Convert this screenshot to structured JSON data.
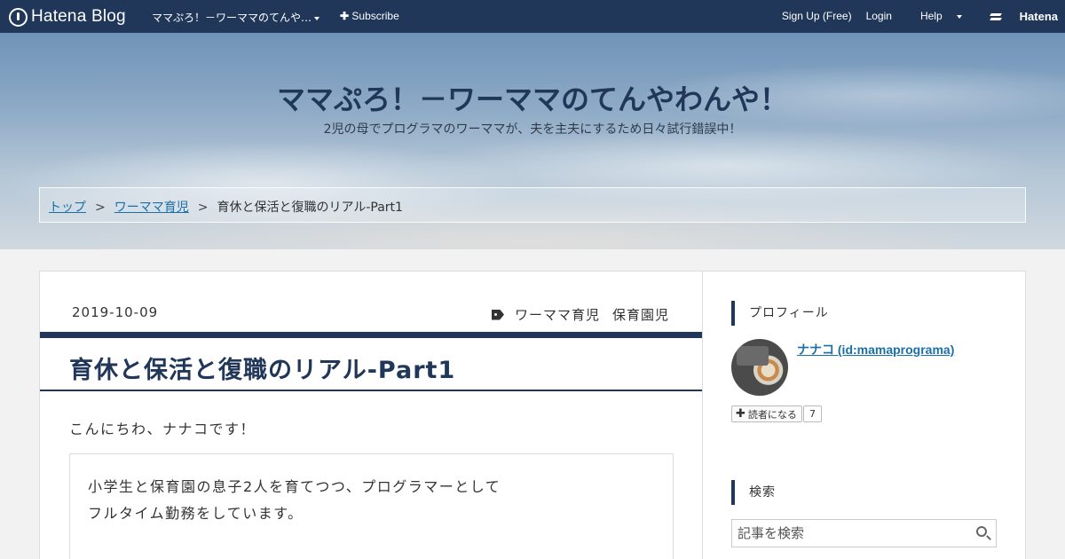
{
  "global_header": {
    "logo": "Hatena Blog",
    "blog_menu": "ママぷろ！－ワーママのてんや…",
    "subscribe": "Subscribe",
    "sign_up": "Sign Up (Free)",
    "login": "Login",
    "help": "Help",
    "brand": "Hatena"
  },
  "blog": {
    "title": "ママぷろ！－ワーママのてんやわんや！",
    "description": "2児の母でプログラマのワーママが、夫を主夫にするため日々試行錯誤中！"
  },
  "breadcrumb": {
    "items": [
      "トップ",
      "ワーママ育児",
      "育休と保活と復職のリアル-Part1"
    ],
    "separator": ">"
  },
  "entry": {
    "date": "2019-10-09",
    "categories": [
      "ワーママ育児",
      "保育園児"
    ],
    "title": "育休と保活と復職のリアル-Part1",
    "greeting": "こんにちわ、ナナコです！",
    "quote_lines": [
      "小学生と保育園の息子2人を育てつつ、プログラマーとして",
      "フルタイム勤務をしています。"
    ]
  },
  "sidebar": {
    "profile_heading": "プロフィール",
    "profile_name": "ナナコ (id:mamaprograma)",
    "subscribe_label": "読者になる",
    "reader_count": "7",
    "search_heading": "検索",
    "search_placeholder": "記事を検索"
  },
  "colors": {
    "header_bg": "#20375a",
    "link": "#1b6fa8",
    "accent": "#20375a"
  },
  "icons": {
    "logo": "hatena-blog-logo-icon",
    "plus": "plus-icon",
    "tag": "tag-icon",
    "search": "search-icon"
  }
}
